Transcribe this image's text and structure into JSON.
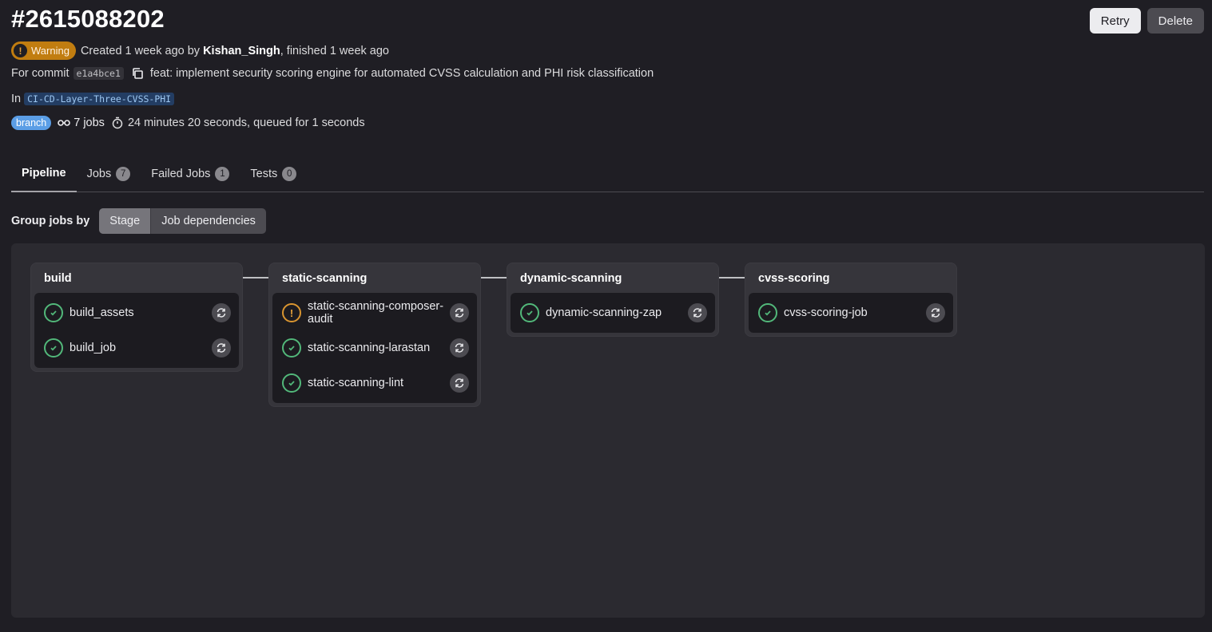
{
  "header": {
    "title": "#2615088202",
    "retry_label": "Retry",
    "delete_label": "Delete"
  },
  "status": {
    "badge": "Warning",
    "created": "Created 1 week ago by",
    "author": "Kishan_Singh",
    "finished": ", finished 1 week ago"
  },
  "commit": {
    "prefix": "For commit",
    "sha": "e1a4bce1",
    "message": "feat: implement security scoring engine for automated CVSS calculation and PHI risk classification"
  },
  "ref": {
    "prefix": "In",
    "branch_name": "CI-CD-Layer-Three-CVSS-PHI"
  },
  "summary": {
    "ref_type": "branch",
    "jobs": "7 jobs",
    "duration": "24 minutes 20 seconds, queued for 1 seconds"
  },
  "tabs": [
    {
      "label": "Pipeline",
      "count": null
    },
    {
      "label": "Jobs",
      "count": "7"
    },
    {
      "label": "Failed Jobs",
      "count": "1"
    },
    {
      "label": "Tests",
      "count": "0"
    }
  ],
  "grouping": {
    "label": "Group jobs by",
    "options": [
      "Stage",
      "Job dependencies"
    ],
    "selected": "Stage"
  },
  "stages": [
    {
      "name": "build",
      "jobs": [
        {
          "name": "build_assets",
          "status": "success"
        },
        {
          "name": "build_job",
          "status": "success"
        }
      ]
    },
    {
      "name": "static-scanning",
      "jobs": [
        {
          "name": "static-scanning-composer-audit",
          "status": "warning"
        },
        {
          "name": "static-scanning-larastan",
          "status": "success"
        },
        {
          "name": "static-scanning-lint",
          "status": "success"
        }
      ]
    },
    {
      "name": "dynamic-scanning",
      "jobs": [
        {
          "name": "dynamic-scanning-zap",
          "status": "success"
        }
      ]
    },
    {
      "name": "cvss-scoring",
      "jobs": [
        {
          "name": "cvss-scoring-job",
          "status": "success"
        }
      ]
    }
  ],
  "colors": {
    "success": "#52b87a",
    "warning": "#d99530",
    "branch_badge": "#5b9ee6"
  }
}
